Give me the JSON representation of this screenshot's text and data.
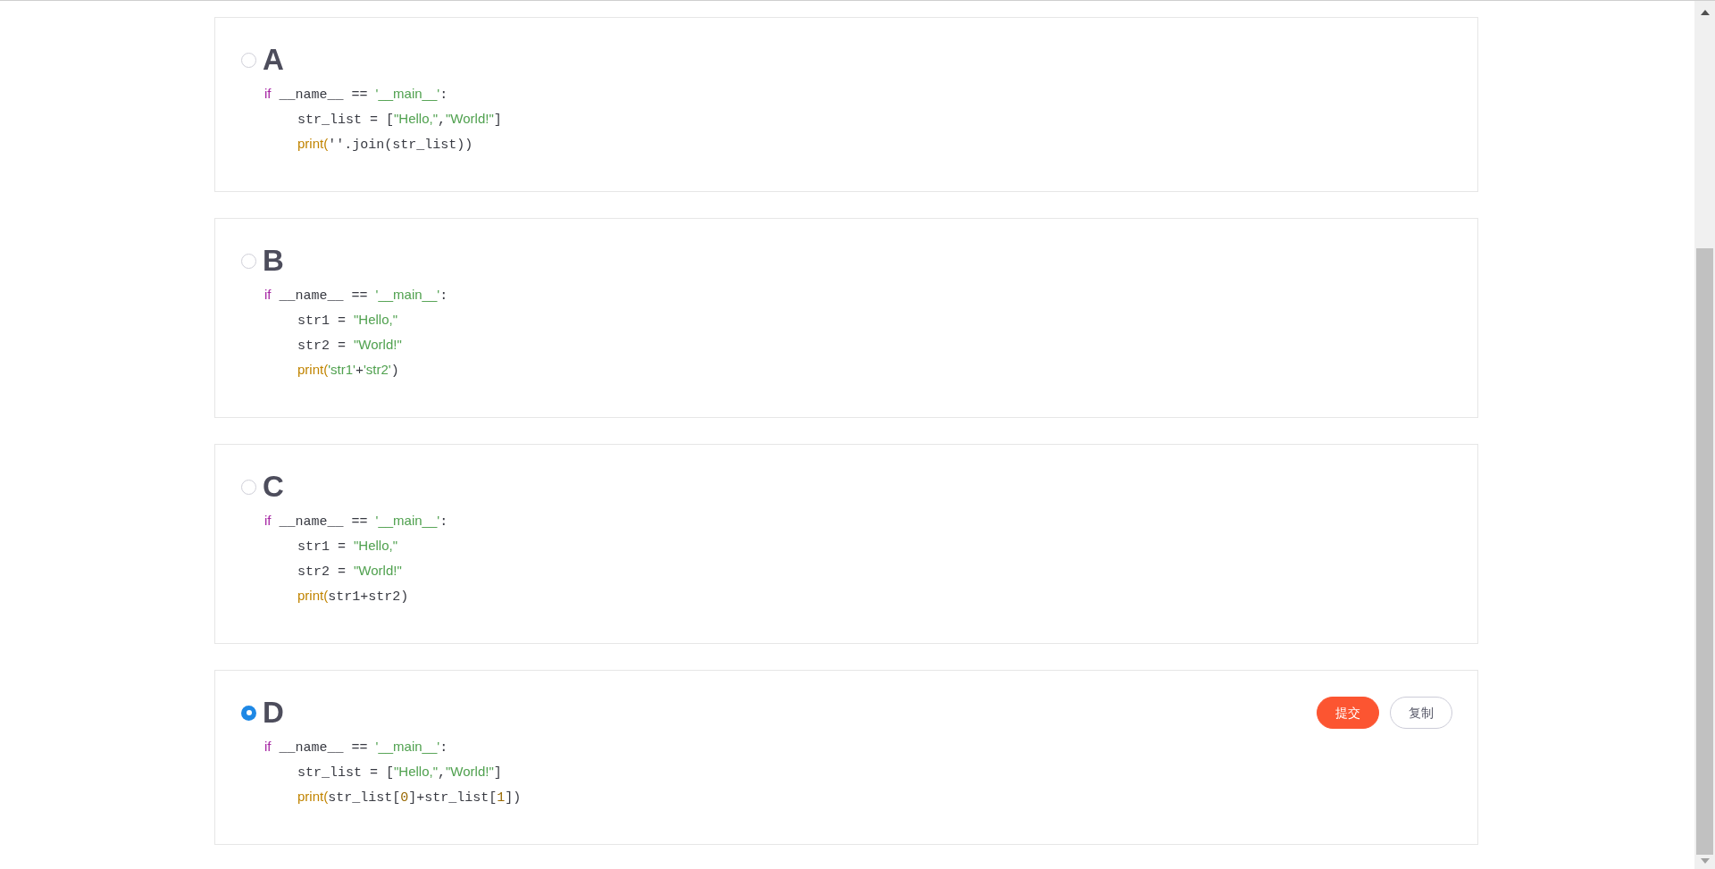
{
  "options": [
    {
      "letter": "A",
      "selected": false,
      "code": {
        "tokens": [
          {
            "kind": "keyword",
            "text": "if"
          },
          {
            "kind": "plain",
            "text": " __name__ == "
          },
          {
            "kind": "string",
            "text": "'__main__'"
          },
          {
            "kind": "plain",
            "text": ":"
          }
        ],
        "children": [
          {
            "tokens": [
              {
                "kind": "plain",
                "text": "str_list = ["
              },
              {
                "kind": "string",
                "text": "\"Hello,\""
              },
              {
                "kind": "plain",
                "text": ","
              },
              {
                "kind": "string",
                "text": "\"World!\""
              },
              {
                "kind": "plain",
                "text": "]"
              }
            ]
          },
          {
            "tokens": [
              {
                "kind": "builtin",
                "text": "print("
              },
              {
                "kind": "plain",
                "text": "''.join(str_list))"
              }
            ]
          }
        ]
      }
    },
    {
      "letter": "B",
      "selected": false,
      "code": {
        "tokens": [
          {
            "kind": "keyword",
            "text": "if"
          },
          {
            "kind": "plain",
            "text": " __name__ == "
          },
          {
            "kind": "string",
            "text": "'__main__'"
          },
          {
            "kind": "plain",
            "text": ":"
          }
        ],
        "children": [
          {
            "tokens": [
              {
                "kind": "plain",
                "text": "str1 = "
              },
              {
                "kind": "string",
                "text": "\"Hello,\""
              }
            ]
          },
          {
            "tokens": [
              {
                "kind": "plain",
                "text": "str2 = "
              },
              {
                "kind": "string",
                "text": "\"World!\""
              }
            ]
          },
          {
            "tokens": [
              {
                "kind": "builtin",
                "text": "print("
              },
              {
                "kind": "string",
                "text": "'str1'"
              },
              {
                "kind": "plain",
                "text": "+"
              },
              {
                "kind": "string",
                "text": "'str2'"
              },
              {
                "kind": "plain",
                "text": ")"
              }
            ]
          }
        ]
      }
    },
    {
      "letter": "C",
      "selected": false,
      "code": {
        "tokens": [
          {
            "kind": "keyword",
            "text": "if"
          },
          {
            "kind": "plain",
            "text": " __name__ == "
          },
          {
            "kind": "string",
            "text": "'__main__'"
          },
          {
            "kind": "plain",
            "text": ":"
          }
        ],
        "children": [
          {
            "tokens": [
              {
                "kind": "plain",
                "text": "str1 = "
              },
              {
                "kind": "string",
                "text": "\"Hello,\""
              }
            ]
          },
          {
            "tokens": [
              {
                "kind": "plain",
                "text": "str2 = "
              },
              {
                "kind": "string",
                "text": "\"World!\""
              }
            ]
          },
          {
            "tokens": [
              {
                "kind": "builtin",
                "text": "print("
              },
              {
                "kind": "plain",
                "text": "str1+str2)"
              }
            ]
          }
        ]
      }
    },
    {
      "letter": "D",
      "selected": true,
      "code": {
        "tokens": [
          {
            "kind": "keyword",
            "text": "if"
          },
          {
            "kind": "plain",
            "text": " __name__ == "
          },
          {
            "kind": "string",
            "text": "'__main__'"
          },
          {
            "kind": "plain",
            "text": ":"
          }
        ],
        "children": [
          {
            "tokens": [
              {
                "kind": "plain",
                "text": "str_list = ["
              },
              {
                "kind": "string",
                "text": "\"Hello,\""
              },
              {
                "kind": "plain",
                "text": ","
              },
              {
                "kind": "string",
                "text": "\"World!\""
              },
              {
                "kind": "plain",
                "text": "]"
              }
            ]
          },
          {
            "tokens": [
              {
                "kind": "builtin",
                "text": "print("
              },
              {
                "kind": "plain",
                "text": "str_list["
              },
              {
                "kind": "number",
                "text": "0"
              },
              {
                "kind": "plain",
                "text": "]+str_list["
              },
              {
                "kind": "number",
                "text": "1"
              },
              {
                "kind": "plain",
                "text": "])"
              }
            ]
          }
        ]
      },
      "buttons": [
        {
          "kind": "primary",
          "label": "提交"
        },
        {
          "kind": "outline",
          "label": "复制"
        }
      ]
    }
  ]
}
